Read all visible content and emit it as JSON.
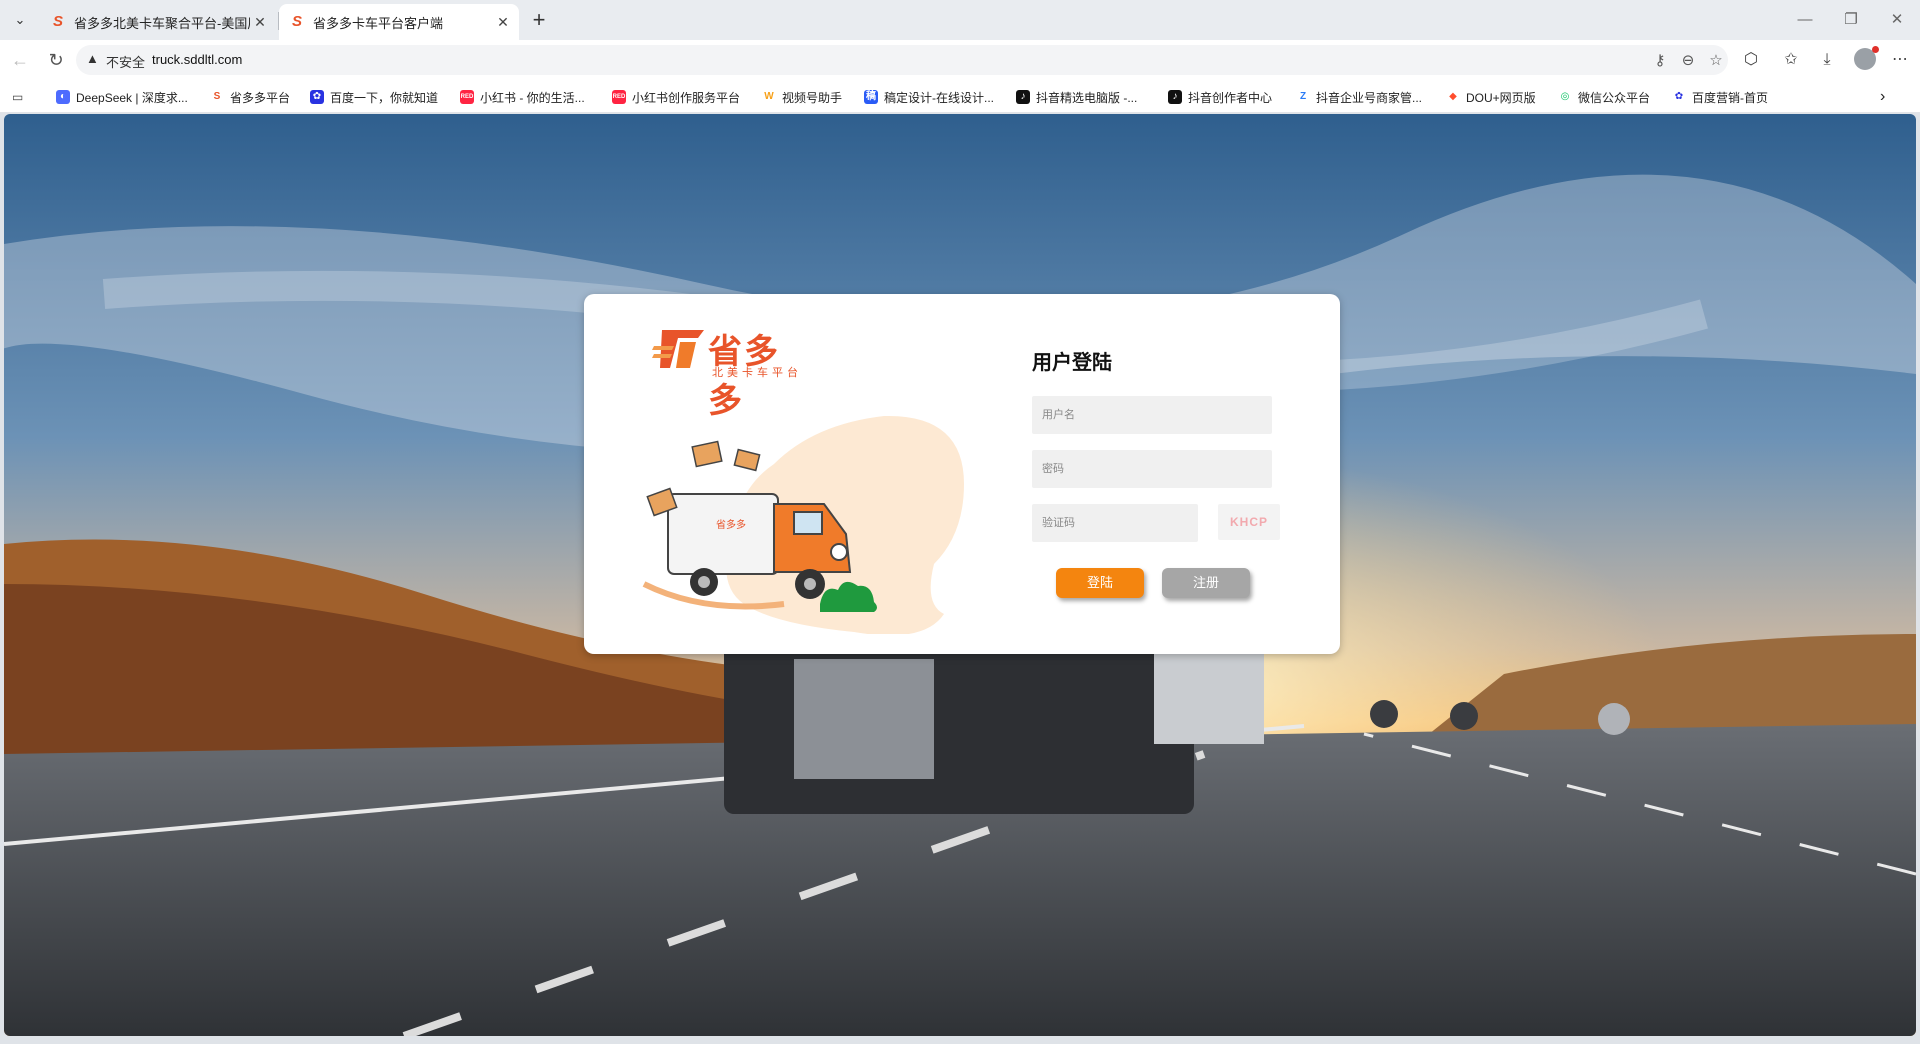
{
  "browser": {
    "tabs": [
      {
        "title": "省多多北美卡车聚合平台-美国尾板",
        "active": false
      },
      {
        "title": "省多多卡车平台客户端",
        "active": true
      }
    ],
    "address": {
      "security_label": "不安全",
      "url": "truck.sddltl.com"
    },
    "bookmarks": [
      {
        "label": "DeepSeek | 深度求...",
        "icon": "deepseek-icon",
        "color": "#4d6bfe"
      },
      {
        "label": "省多多平台",
        "icon": "sdd-icon",
        "color": "#e8542a"
      },
      {
        "label": "百度一下，你就知道",
        "icon": "baidu-icon",
        "color": "#2932e1"
      },
      {
        "label": "小红书 - 你的生活...",
        "icon": "xiaohongshu-icon",
        "color": "#ff2442"
      },
      {
        "label": "小红书创作服务平台",
        "icon": "xiaohongshu-icon",
        "color": "#ff2442"
      },
      {
        "label": "视频号助手",
        "icon": "wechat-channels-icon",
        "color": "#f7a11a"
      },
      {
        "label": "稿定设计-在线设计...",
        "icon": "gaoding-icon",
        "color": "#2a5bf6"
      },
      {
        "label": "抖音精选电脑版 -...",
        "icon": "douyin-icon",
        "color": "#111111"
      },
      {
        "label": "抖音创作者中心",
        "icon": "douyin-icon",
        "color": "#111111"
      },
      {
        "label": "抖音企业号商家管...",
        "icon": "douyin-enterprise-icon",
        "color": "#2a7bf6"
      },
      {
        "label": "DOU+网页版",
        "icon": "dou-plus-icon",
        "color": "#ff4d2d"
      },
      {
        "label": "微信公众平台",
        "icon": "wechat-mp-icon",
        "color": "#07c160"
      },
      {
        "label": "百度营销-首页",
        "icon": "baidu-marketing-icon",
        "color": "#2932e1"
      }
    ]
  },
  "login": {
    "logo_text": "省多多",
    "logo_subtext": "北美卡车平台",
    "title": "用户登陆",
    "username_placeholder": "用户名",
    "password_placeholder": "密码",
    "captcha_placeholder": "验证码",
    "captcha_code": "KHCP",
    "login_button": "登陆",
    "register_button": "注册"
  },
  "colors": {
    "brand_orange": "#e8542a",
    "login_button": "#f4850f",
    "register_button": "#a6a6a6"
  }
}
